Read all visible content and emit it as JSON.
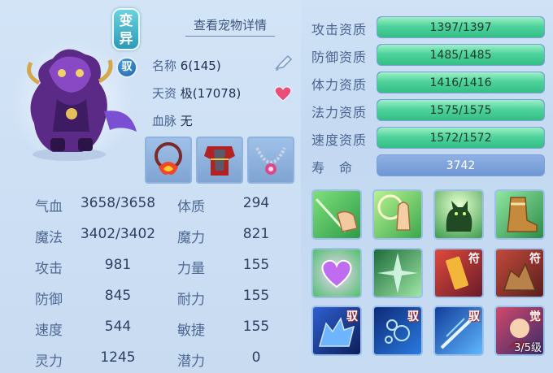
{
  "pet": {
    "mutant_badge": "变异",
    "ride_badge": "驭",
    "detail_link": "查看宠物详情",
    "name_label": "名称",
    "name_value": "6(145)",
    "talent_label": "天资",
    "talent_value": "极(17078)",
    "bloodline_label": "血脉",
    "bloodline_value": "无"
  },
  "stats_left": [
    {
      "label": "气血",
      "value": "3658/3658"
    },
    {
      "label": "魔法",
      "value": "3402/3402"
    },
    {
      "label": "攻击",
      "value": "981"
    },
    {
      "label": "防御",
      "value": "845"
    },
    {
      "label": "速度",
      "value": "544"
    },
    {
      "label": "灵力",
      "value": "1245"
    }
  ],
  "stats_right": [
    {
      "label": "体质",
      "value": "294"
    },
    {
      "label": "魔力",
      "value": "821"
    },
    {
      "label": "力量",
      "value": "155"
    },
    {
      "label": "耐力",
      "value": "155"
    },
    {
      "label": "敏捷",
      "value": "155"
    },
    {
      "label": "潜力",
      "value": "0"
    }
  ],
  "aptitudes": [
    {
      "label": "攻击资质",
      "value": "1397/1397",
      "fill": 1.0
    },
    {
      "label": "防御资质",
      "value": "1485/1485",
      "fill": 1.0
    },
    {
      "label": "体力资质",
      "value": "1416/1416",
      "fill": 1.0
    },
    {
      "label": "法力资质",
      "value": "1575/1575",
      "fill": 1.0
    },
    {
      "label": "速度资质",
      "value": "1572/1572",
      "fill": 1.0
    }
  ],
  "lifespan": {
    "label": "寿　命",
    "value": "3742"
  },
  "skills": [
    {
      "name": "hand-skill-icon"
    },
    {
      "name": "palm-skill-icon"
    },
    {
      "name": "cat-skill-icon"
    },
    {
      "name": "boot-skill-icon"
    },
    {
      "name": "heart-skill-icon"
    },
    {
      "name": "shatter-skill-icon"
    },
    {
      "name": "talisman-fire-skill-icon",
      "tag": "符"
    },
    {
      "name": "talisman-rock-skill-icon",
      "tag": "符"
    },
    {
      "name": "wolf-ride-skill-icon",
      "tag": "驭"
    },
    {
      "name": "bubble-ride-skill-icon",
      "tag": "驭"
    },
    {
      "name": "slash-ride-skill-icon",
      "tag": "驭"
    },
    {
      "name": "awaken-skill-icon",
      "tag": "觉",
      "level": "3/5级"
    }
  ],
  "colors": {
    "bar_fill": "#4fd39c",
    "bar_track": "#5f8ed1",
    "label_text": "#4a6490"
  }
}
